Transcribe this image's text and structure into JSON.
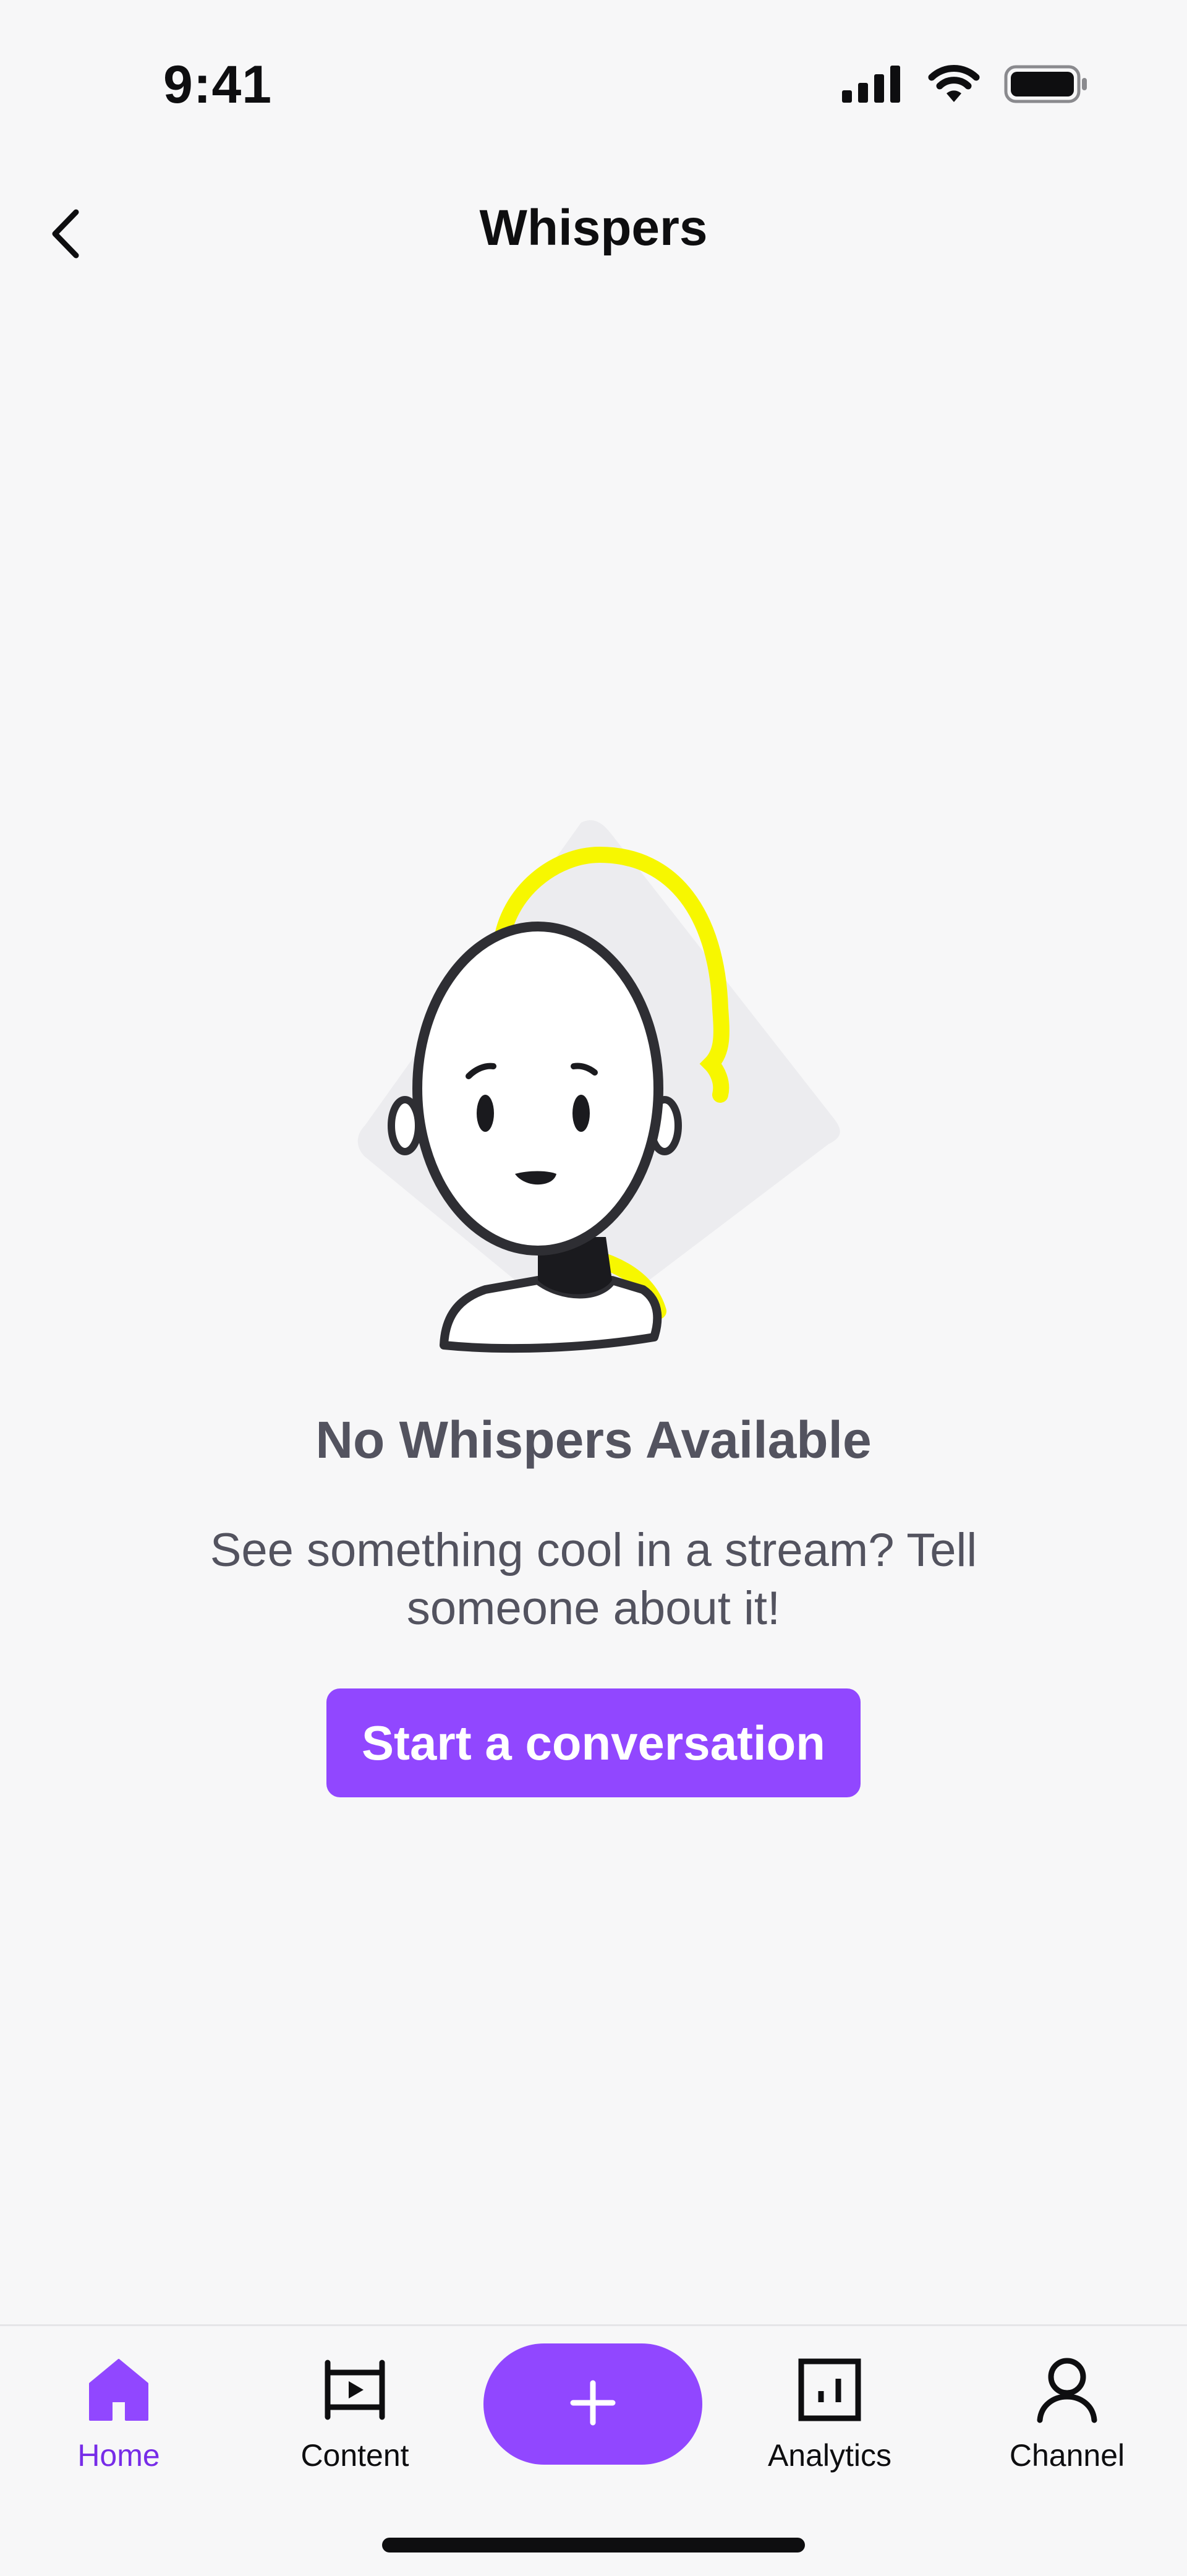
{
  "status_bar": {
    "time": "9:41",
    "icons": [
      "cellular-signal-icon",
      "wifi-icon",
      "battery-icon"
    ]
  },
  "nav": {
    "title": "Whispers",
    "back_icon": "chevron-left-icon"
  },
  "empty_state": {
    "illustration": "confused-person-illustration",
    "title": "No Whispers Available",
    "message": "See something cool in a stream? Tell someone about it!",
    "cta_label": "Start a conversation"
  },
  "tab_bar": {
    "tabs": [
      {
        "label": "Home",
        "icon": "home-icon",
        "active": true
      },
      {
        "label": "Content",
        "icon": "film-icon",
        "active": false
      },
      {
        "label": "Analytics",
        "icon": "bar-chart-icon",
        "active": false
      },
      {
        "label": "Channel",
        "icon": "user-icon",
        "active": false
      }
    ],
    "create_icon": "plus-icon"
  },
  "colors": {
    "accent": "#9147ff",
    "accent_text": "#772ce8",
    "background": "#f7f7f8",
    "muted_text": "#53535f",
    "illustration_highlight": "#f7f700"
  }
}
